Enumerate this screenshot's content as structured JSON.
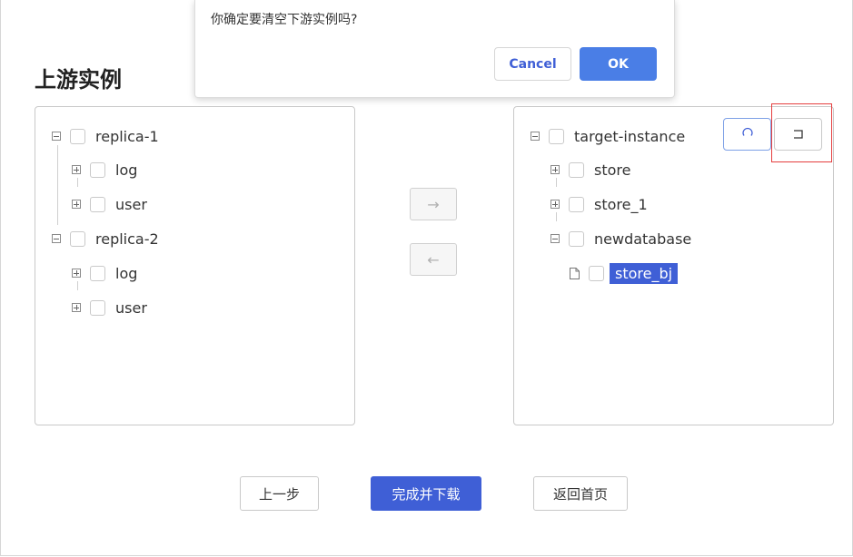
{
  "dialog": {
    "message": "你确定要清空下游实例吗?",
    "cancel_label": "Cancel",
    "ok_label": "OK"
  },
  "section_title": "上游实例",
  "left_tree": {
    "nodes": [
      {
        "label": "replica-1",
        "expanded": true
      },
      {
        "label": "log",
        "expanded": false
      },
      {
        "label": "user",
        "expanded": false
      },
      {
        "label": "replica-2",
        "expanded": true
      },
      {
        "label": "log",
        "expanded": false
      },
      {
        "label": "user",
        "expanded": false
      }
    ]
  },
  "right_tree": {
    "nodes": [
      {
        "label": "target-instance",
        "expanded": true
      },
      {
        "label": "store",
        "expanded": false
      },
      {
        "label": "store_1",
        "expanded": false
      },
      {
        "label": "newdatabase",
        "expanded": true
      },
      {
        "label": "store_bj",
        "selected": true
      }
    ]
  },
  "transfer": {
    "right_arrow": "→",
    "left_arrow": "←"
  },
  "icons": {
    "refresh": "refresh-icon",
    "undo": "undo-icon"
  },
  "footer": {
    "prev_label": "上一步",
    "finish_label": "完成并下载",
    "home_label": "返回首页"
  },
  "colors": {
    "primary": "#3f5fd6",
    "ok_button": "#4a7ee6",
    "highlight": "#e53e3e"
  }
}
